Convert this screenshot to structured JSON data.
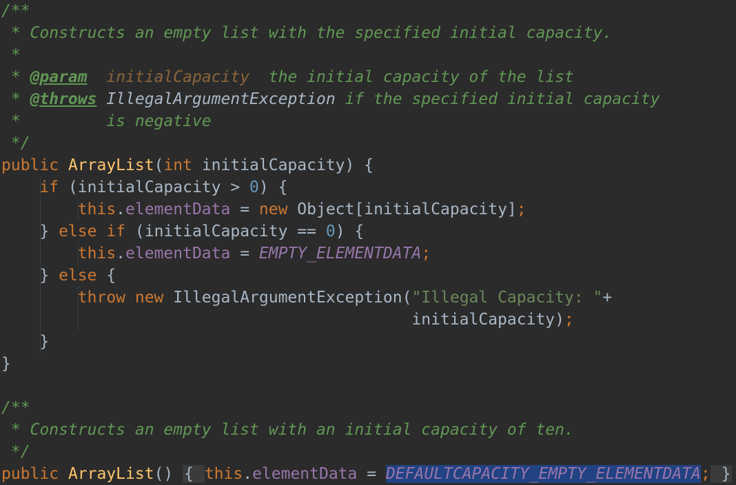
{
  "editor": {
    "lines": [
      {
        "tokens": [
          {
            "t": "/**",
            "c": "c-doc"
          }
        ]
      },
      {
        "tokens": [
          {
            "t": " * Constructs an empty list with the specified initial capacity.",
            "c": "c-doc"
          }
        ]
      },
      {
        "tokens": [
          {
            "t": " *",
            "c": "c-doc"
          }
        ]
      },
      {
        "tokens": [
          {
            "t": " * ",
            "c": "c-doc"
          },
          {
            "t": "@param",
            "c": "c-tag"
          },
          {
            "t": "  ",
            "c": "c-doc"
          },
          {
            "t": "initialCapacity",
            "c": "c-param"
          },
          {
            "t": "  the initial capacity of the list",
            "c": "c-doc"
          }
        ]
      },
      {
        "tokens": [
          {
            "t": " * ",
            "c": "c-doc"
          },
          {
            "t": "@throws",
            "c": "c-tag"
          },
          {
            "t": " ",
            "c": "c-doc"
          },
          {
            "t": "IllegalArgumentException",
            "c": "c-ref"
          },
          {
            "t": " if the specified initial capacity",
            "c": "c-doc"
          }
        ]
      },
      {
        "tokens": [
          {
            "t": " *         is negative",
            "c": "c-doc"
          }
        ]
      },
      {
        "tokens": [
          {
            "t": " */",
            "c": "c-doc"
          }
        ]
      },
      {
        "tokens": [
          {
            "t": "public ",
            "c": "kw"
          },
          {
            "t": "ArrayList",
            "c": "fn"
          },
          {
            "t": "(",
            "c": "plain"
          },
          {
            "t": "int ",
            "c": "kw"
          },
          {
            "t": "initialCapacity) {",
            "c": "plain"
          }
        ]
      },
      {
        "tokens": [
          {
            "t": "    ",
            "c": "plain"
          },
          {
            "t": "if ",
            "c": "kw"
          },
          {
            "t": "(initialCapacity > ",
            "c": "plain"
          },
          {
            "t": "0",
            "c": "num"
          },
          {
            "t": ") {",
            "c": "plain"
          }
        ]
      },
      {
        "tokens": [
          {
            "t": "        ",
            "c": "plain"
          },
          {
            "t": "this",
            "c": "kw"
          },
          {
            "t": ".",
            "c": "plain"
          },
          {
            "t": "elementData",
            "c": "fld"
          },
          {
            "t": " = ",
            "c": "plain"
          },
          {
            "t": "new ",
            "c": "kw"
          },
          {
            "t": "Object[initialCapacity]",
            "c": "plain"
          },
          {
            "t": ";",
            "c": "punct"
          }
        ]
      },
      {
        "tokens": [
          {
            "t": "    } ",
            "c": "plain"
          },
          {
            "t": "else if ",
            "c": "kw"
          },
          {
            "t": "(initialCapacity == ",
            "c": "plain"
          },
          {
            "t": "0",
            "c": "num"
          },
          {
            "t": ") {",
            "c": "plain"
          }
        ]
      },
      {
        "tokens": [
          {
            "t": "        ",
            "c": "plain"
          },
          {
            "t": "this",
            "c": "kw"
          },
          {
            "t": ".",
            "c": "plain"
          },
          {
            "t": "elementData",
            "c": "fld"
          },
          {
            "t": " = ",
            "c": "plain"
          },
          {
            "t": "EMPTY_ELEMENTDATA",
            "c": "const"
          },
          {
            "t": ";",
            "c": "punct"
          }
        ]
      },
      {
        "tokens": [
          {
            "t": "    } ",
            "c": "plain"
          },
          {
            "t": "else ",
            "c": "kw"
          },
          {
            "t": "{",
            "c": "plain"
          }
        ]
      },
      {
        "tokens": [
          {
            "t": "        ",
            "c": "plain"
          },
          {
            "t": "throw new ",
            "c": "kw"
          },
          {
            "t": "IllegalArgumentException(",
            "c": "plain"
          },
          {
            "t": "\"Illegal Capacity: \"",
            "c": "str"
          },
          {
            "t": "+",
            "c": "plain"
          }
        ]
      },
      {
        "tokens": [
          {
            "t": "                                           initialCapacity)",
            "c": "plain"
          },
          {
            "t": ";",
            "c": "punct"
          }
        ]
      },
      {
        "tokens": [
          {
            "t": "    }",
            "c": "plain"
          }
        ]
      },
      {
        "tokens": [
          {
            "t": "}",
            "c": "plain"
          }
        ]
      },
      {
        "tokens": [
          {
            "t": "",
            "c": "plain"
          }
        ]
      },
      {
        "tokens": [
          {
            "t": "/**",
            "c": "c-doc"
          }
        ]
      },
      {
        "tokens": [
          {
            "t": " * Constructs an empty list with an initial capacity of ten.",
            "c": "c-doc"
          }
        ]
      },
      {
        "tokens": [
          {
            "t": " */",
            "c": "c-doc"
          }
        ]
      },
      {
        "tokens": [
          {
            "t": "public ",
            "c": "kw"
          },
          {
            "t": "ArrayList",
            "c": "fn"
          },
          {
            "t": "() ",
            "c": "plain"
          },
          {
            "t": "{ ",
            "c": "plain fold-brace"
          },
          {
            "t": "this",
            "c": "kw"
          },
          {
            "t": ".",
            "c": "plain"
          },
          {
            "t": "elementData",
            "c": "fld"
          },
          {
            "t": " = ",
            "c": "plain"
          },
          {
            "t": "DEFAULTCAPACITY_EMPTY_ELEMENTDATA",
            "c": "const sel"
          },
          {
            "t": ";",
            "c": "punct"
          },
          {
            "t": " }",
            "c": "plain fold-brace"
          }
        ]
      }
    ]
  }
}
